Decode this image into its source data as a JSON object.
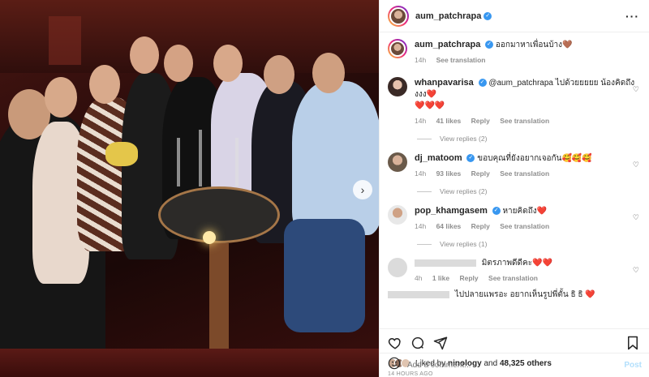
{
  "post": {
    "author": "aum_patchrapa",
    "caption": "ออกมาหาเพื่อนบ้าง🤎",
    "caption_time": "14h",
    "see_translation": "See translation"
  },
  "comments": [
    {
      "user": "whanpavarisa",
      "verified": true,
      "text": "@aum_patchrapa ไปด้วยยยยย น้องคิดถึงงงง❤️",
      "extra": "❤️❤️❤️",
      "time": "14h",
      "likes": "41 likes",
      "reply": "Reply",
      "translate": "See translation",
      "view_replies": "View replies (2)"
    },
    {
      "user": "dj_matoom",
      "verified": true,
      "text": "ขอบคุณที่ยังอยากเจอกัน🥰🥰🥰",
      "time": "14h",
      "likes": "93 likes",
      "reply": "Reply",
      "translate": "See translation",
      "view_replies": "View replies (2)"
    },
    {
      "user": "pop_khamgasem",
      "verified": true,
      "text": "หายคิดถึง❤️",
      "time": "14h",
      "likes": "64 likes",
      "reply": "Reply",
      "translate": "See translation",
      "view_replies": "View replies (1)"
    },
    {
      "text": "มิตรภาพดีดีคะ❤️❤️",
      "time": "4h",
      "likes": "1 like",
      "reply": "Reply",
      "translate": "See translation"
    },
    {
      "text": "ไปปลายแพรอะ อยากเห็นรูปพี่ตั้น ธิ ธิ ❤️"
    }
  ],
  "engagement": {
    "liked_by_prefix": "Liked by",
    "liked_by_user": "ninology",
    "and": "and",
    "others": "48,325 others",
    "time_ago": "14 HOURS AGO"
  },
  "compose": {
    "placeholder": "Add a comment...",
    "post_label": "Post"
  },
  "colors": {
    "accent_blue": "#3897f0",
    "heart_red": "#ed4956",
    "muted": "#8e8e8e"
  }
}
